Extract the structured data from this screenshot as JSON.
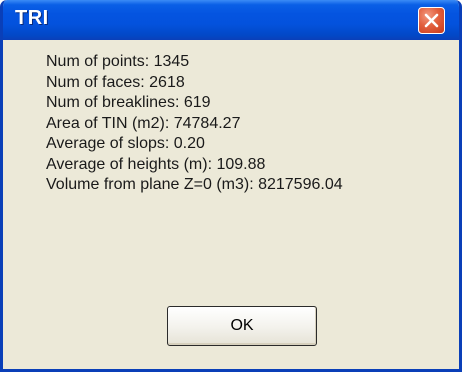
{
  "window": {
    "title": "TRI"
  },
  "info": {
    "lines": [
      "Num of points:  1345",
      "Num of faces:  2618",
      "Num of breaklines:  619",
      "Area of TIN (m2): 74784.27",
      "Average of slops: 0.20",
      "Average of heights (m): 109.88",
      "Volume from plane Z=0 (m3): 8217596.04"
    ]
  },
  "buttons": {
    "ok_label": "OK"
  },
  "icons": {
    "close": "close-icon"
  },
  "colors": {
    "titlebar": "#0454e0",
    "close_button": "#e2603f",
    "dialog_background": "#ece9d8"
  }
}
